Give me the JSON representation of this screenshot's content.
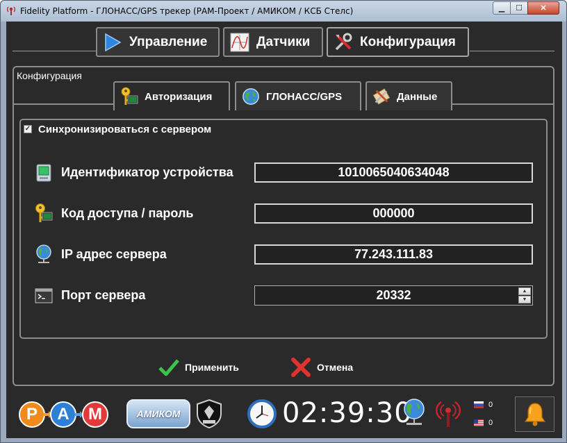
{
  "window": {
    "title": "Fidelity Platform - ГЛОНАСС/GPS трекер (РАМ-Проект / АМИКОМ / КСБ Стелс)",
    "icon": "antenna-icon"
  },
  "top_tabs": [
    {
      "label": "Управление",
      "icon": "play-icon",
      "active": false
    },
    {
      "label": "Датчики",
      "icon": "chart-icon",
      "active": false
    },
    {
      "label": "Конфигурация",
      "icon": "tools-icon",
      "active": true
    }
  ],
  "config": {
    "group_title": "Конфигурация",
    "sub_tabs": [
      {
        "label": "Авторизация",
        "icon": "key-icon",
        "active": true
      },
      {
        "label": "ГЛОНАСС/GPS",
        "icon": "globe-icon",
        "active": false
      },
      {
        "label": "Данные",
        "icon": "data-tools-icon",
        "active": false
      }
    ],
    "sync_checkbox": {
      "label": "Синхронизироваться с сервером",
      "checked": true
    },
    "fields": [
      {
        "label": "Идентификатор устройства",
        "value": "1010065040634048",
        "icon": "device-icon"
      },
      {
        "label": "Код доступа / пароль",
        "value": "000000",
        "icon": "key-icon"
      },
      {
        "label": "IP адрес сервера",
        "value": "77.243.111.83",
        "icon": "network-globe-icon"
      },
      {
        "label": "Порт сервера",
        "value": "20332",
        "icon": "terminal-icon"
      }
    ],
    "apply_label": "Применить",
    "cancel_label": "Отмена"
  },
  "status": {
    "logo_letters": [
      "Р",
      "А",
      "М"
    ],
    "amikom_label": "АМИКОМ",
    "time": "02:39:30",
    "ru_count": "0",
    "us_count": "0"
  },
  "colors": {
    "background": "#2a2a2a",
    "border": "#8d8d8d",
    "text": "#ffffff",
    "apply_green": "#3cc34a",
    "cancel_red": "#e0322f"
  }
}
